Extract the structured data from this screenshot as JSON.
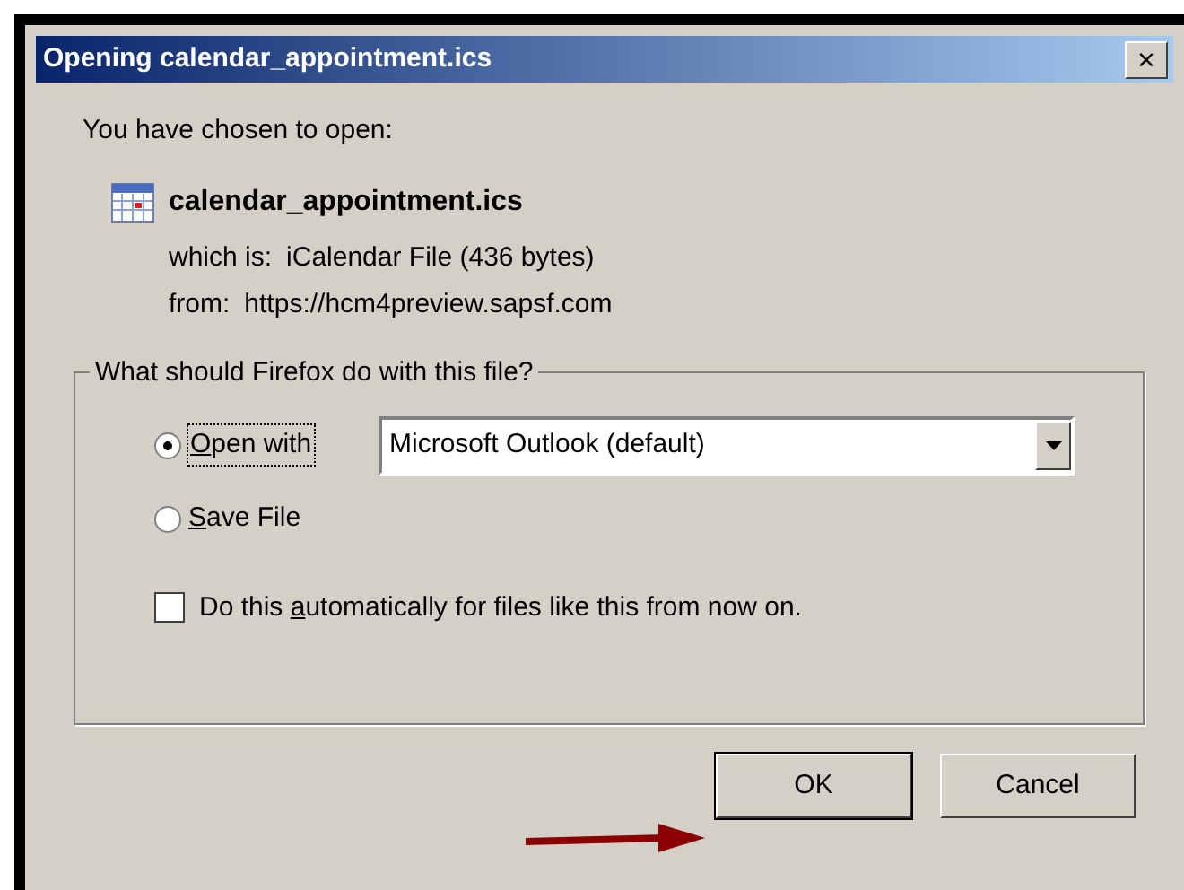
{
  "window": {
    "title": "Opening calendar_appointment.ics",
    "close": "×"
  },
  "intro": "You have chosen to open:",
  "file": {
    "name": "calendar_appointment.ics",
    "type_label": "which is:",
    "type_value": "iCalendar File (436 bytes)",
    "from_label": "from:",
    "from_value": "https://hcm4preview.sapsf.com"
  },
  "group": {
    "legend": "What should Firefox do with this file?",
    "options": [
      {
        "kind": "radio",
        "access_key": "O",
        "label_post": "pen with",
        "selected": true,
        "focused": true,
        "app": "Microsoft Outlook (default)"
      },
      {
        "kind": "radio",
        "access_key": "S",
        "label_post": "ave File",
        "selected": false,
        "focused": false
      }
    ],
    "auto": {
      "label_pre": "Do this ",
      "access_key": "a",
      "label_post": "utomatically for files like this from now on.",
      "checked": false
    }
  },
  "buttons": [
    {
      "label": "OK",
      "default": true,
      "annotated": true
    },
    {
      "label": "Cancel",
      "default": false,
      "annotated": false
    }
  ]
}
